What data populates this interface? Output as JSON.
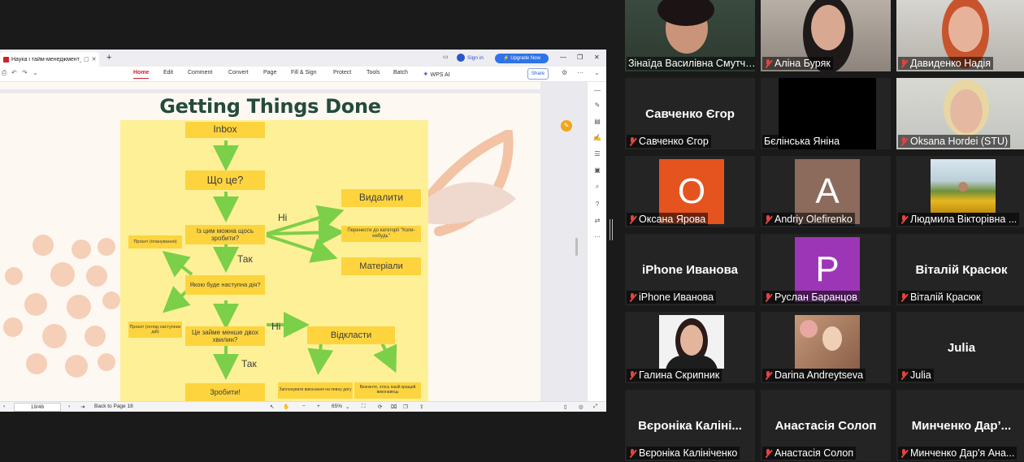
{
  "viewer": {
    "tab_title": "Наука і тайм-менеджмент_е",
    "sign_in": "Sign in",
    "upgrade": "Upgrade Now",
    "menu": [
      "Home",
      "Edit",
      "Comment",
      "Convert",
      "Page",
      "Fill & Sign",
      "Protect",
      "Tools",
      "Batch",
      "WPS AI"
    ],
    "share": "Share",
    "page_indicator": "19/46",
    "back_to_page": "Back to Page 18",
    "zoom": "65%"
  },
  "slide": {
    "title": "Getting Things Done",
    "flow": {
      "inbox": "Inbox",
      "what": "Що це?",
      "can_do": "Із цим можна щось зробити?",
      "delete": "Видалити",
      "someday": "Перенести до категорії \"Коли-небудь\"",
      "materials": "Матеріали",
      "project_plan": "Проєкт (планування)",
      "next_action": "Якою буде наступна дія?",
      "project_review": "Проєкт (огляд наступних дій)",
      "two_minutes": "Це займе менше двох хвилин?",
      "postpone": "Відкласти",
      "do_it": "Зробити!",
      "schedule": "Заплонувати виконання на певну дату",
      "delegate": "Визначте, хтось іншій кращий виконавець",
      "no1": "Ні",
      "yes1": "Так",
      "no2": "Ні",
      "yes2": "Так"
    }
  },
  "participants": [
    {
      "display": "Зінаїда Василівна Смутч...",
      "label": "Зінаїда Василівна Смутч…",
      "type": "video",
      "active": true,
      "muted": false
    },
    {
      "display": "Аліна Буряк",
      "label": "Аліна Буряк",
      "type": "video",
      "muted": true
    },
    {
      "display": "Давиденко Надія",
      "label": "Давиденко Надія",
      "type": "video",
      "muted": true
    },
    {
      "display": "Савченко Єгор",
      "label": "Савченко Єгор",
      "type": "name",
      "muted": true
    },
    {
      "display": "Бєлінська Яніна",
      "label": "Бєлінська Яніна",
      "type": "black",
      "muted": false
    },
    {
      "display": "Oksana Hordei (STU)",
      "label": "Oksana Hordei (STU)",
      "type": "video",
      "muted": true
    },
    {
      "display": "Оксана Ярова",
      "label": "Оксана Ярова",
      "type": "letter",
      "letter": "О",
      "color": "#e5531f",
      "muted": true
    },
    {
      "display": "Andriy Olefirenko",
      "label": "Andriy Olefirenko",
      "type": "letter",
      "letter": "A",
      "color": "#8c6a5c",
      "muted": true
    },
    {
      "display": "Людмила Вікторівна ...",
      "label": "Людмила Вікторівна ...",
      "type": "photo",
      "muted": true
    },
    {
      "display": "iPhone Иванова",
      "label": "iPhone Иванова",
      "type": "name",
      "muted": true
    },
    {
      "display": "Руслан Баранцов",
      "label": "Руслан Баранцов",
      "type": "letter",
      "letter": "P",
      "color": "#9d36b6",
      "muted": true
    },
    {
      "display": "Віталій Красюк",
      "label": "Віталій Красюк",
      "type": "name",
      "muted": true
    },
    {
      "display": "Галина Скрипник",
      "label": "Галина Скрипник",
      "type": "photo",
      "muted": true
    },
    {
      "display": "Darina Andreytseva",
      "label": "Darina Andreytseva",
      "type": "photo",
      "muted": true
    },
    {
      "display": "Julia",
      "label": "Julia",
      "type": "name",
      "muted": true
    },
    {
      "display": "Вєроніка Калінi...",
      "label": "Вєроніка Калініченко",
      "type": "name",
      "muted": true
    },
    {
      "display": "Анастасія Солоп",
      "label": "Анастасія Солоп",
      "type": "name",
      "muted": true
    },
    {
      "display": "Минченко  Дар’...",
      "label": "Минченко Дар'я Ана...",
      "type": "name",
      "muted": true
    }
  ]
}
